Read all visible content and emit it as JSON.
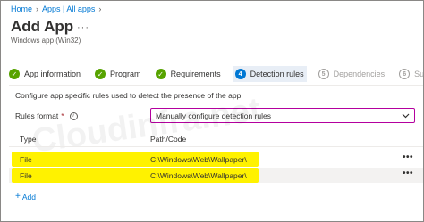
{
  "breadcrumb": {
    "items": [
      "Home",
      "Apps | All apps"
    ]
  },
  "page": {
    "title": "Add App",
    "more": "···",
    "subtitle": "Windows app (Win32)"
  },
  "steps": [
    {
      "label": "App information",
      "state": "done"
    },
    {
      "label": "Program",
      "state": "done"
    },
    {
      "label": "Requirements",
      "state": "done"
    },
    {
      "label": "Detection rules",
      "state": "active",
      "number": "4"
    },
    {
      "label": "Dependencies",
      "state": "future",
      "number": "5"
    },
    {
      "label": "Superse",
      "state": "future",
      "number": "6"
    }
  ],
  "description": "Configure app specific rules used to detect the presence of the app.",
  "rules_format": {
    "label": "Rules format",
    "required_mark": "*",
    "value": "Manually configure detection rules"
  },
  "table": {
    "headers": {
      "type": "Type",
      "path": "Path/Code"
    },
    "rows": [
      {
        "type": "File",
        "path": "C:\\Windows\\Web\\Wallpaper\\",
        "menu": "•••"
      },
      {
        "type": "File",
        "path": "C:\\Windows\\Web\\Wallpaper\\",
        "menu": "•••"
      }
    ]
  },
  "add_label": "Add",
  "watermark": "Cloudinfra.net",
  "colors": {
    "accent": "#0078d4",
    "success": "#57a300",
    "highlight": "#fff200",
    "dropdown_border": "#b4009e"
  }
}
